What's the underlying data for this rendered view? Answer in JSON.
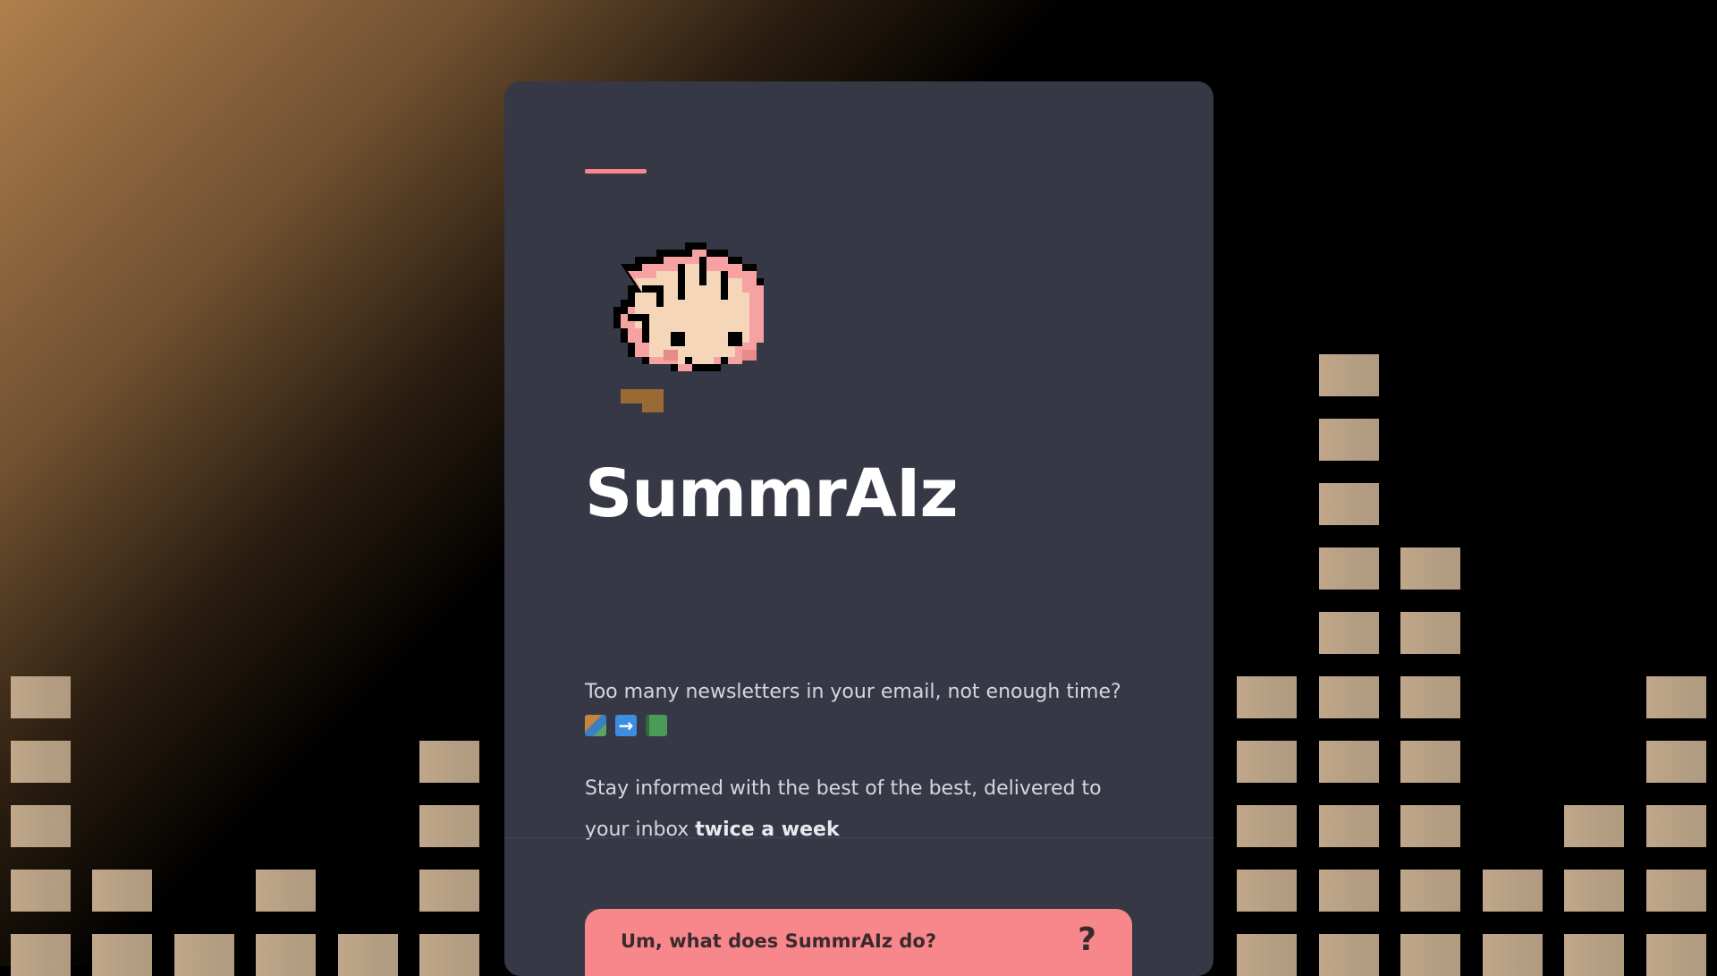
{
  "app": {
    "name": "SummrAIz",
    "tagline": "Too many newsletters in your email, not enough time?",
    "emojis": [
      "books-emoji",
      "right-arrow-emoji",
      "green-book-emoji"
    ],
    "description_prefix": "Stay informed with the best of the best, delivered to your inbox ",
    "description_emphasis": "twice a week"
  },
  "faq": {
    "question": "Um, what does SummrAIz do?",
    "icon": "question-mark-icon",
    "icon_glyph": "?"
  },
  "colors": {
    "card_bg": "#363945",
    "accent": "#f7878a",
    "equalizer_block": "#b49e83",
    "title": "#ffffff",
    "body_text": "#d6d6dc"
  }
}
